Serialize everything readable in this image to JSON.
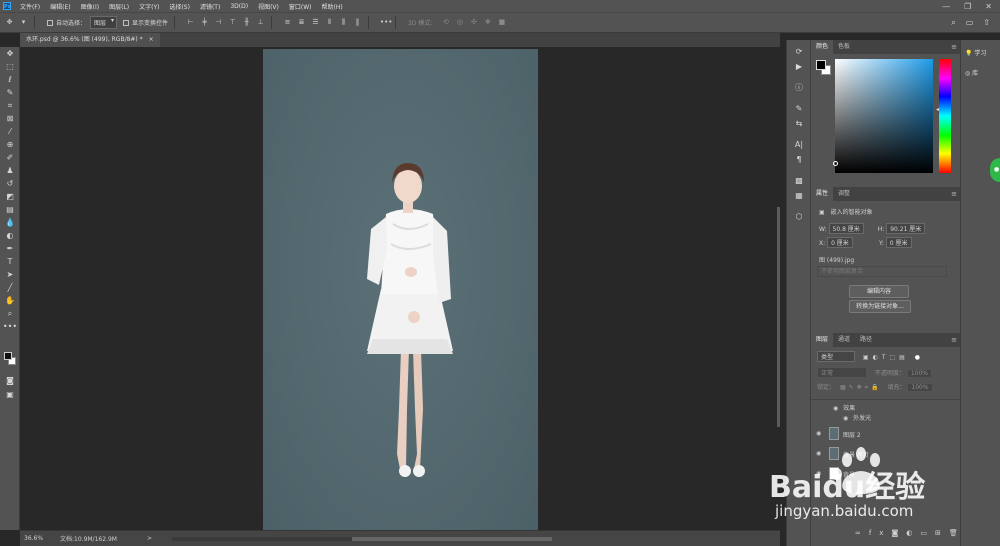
{
  "app": {
    "logo": "Ps"
  },
  "menu": [
    "文件(F)",
    "编辑(E)",
    "图像(I)",
    "图层(L)",
    "文字(Y)",
    "选择(S)",
    "滤镜(T)",
    "3D(D)",
    "视图(V)",
    "窗口(W)",
    "帮助(H)"
  ],
  "options": {
    "auto_select_label": "自动选择：",
    "auto_select_value": "图层",
    "show_transform_label": "显示变换控件",
    "mode_3d_label": "3D 模式："
  },
  "document_tab": {
    "title": "水环.psd @ 36.6% (图 (499), RGB/8#) *",
    "close": "×"
  },
  "status": {
    "zoom": "36.6%",
    "docsize": "文档:10.9M/162.9M",
    "arrow": ">"
  },
  "color_panel": {
    "tabs": [
      "颜色",
      "色板"
    ],
    "hue_marker": "◂"
  },
  "properties_panel": {
    "tabs": [
      "属性",
      "调整"
    ],
    "object_type": "嵌入的智能对象",
    "w_label": "W:",
    "w_value": "50.8 厘米",
    "h_label": "H:",
    "h_value": "90.21 厘米",
    "x_label": "X:",
    "x_value": "0 厘米",
    "y_label": "Y:",
    "y_value": "0 厘米",
    "filename": "图 (499).jpg",
    "comp_placeholder": "不使用图层复合",
    "edit_contents_btn": "编辑内容",
    "convert_linked_btn": "转换为链接对象..."
  },
  "layers_panel": {
    "tabs": [
      "图层",
      "通道",
      "路径"
    ],
    "filter_label": "类型",
    "blend_mode": "正常",
    "opacity_label": "不透明度：",
    "opacity_value": "100%",
    "lock_label": "锁定：",
    "fill_label": "填充：",
    "fill_value": "100%",
    "effects_label": "效果",
    "outer_glow_label": "外发光",
    "layer2_name": "图层 2",
    "bg_name": "背景 拷贝",
    "bg2_name": "背景"
  },
  "right_column": {
    "learn_label": "学习",
    "library_label": "库"
  },
  "watermark": {
    "brand": "Baidu经验",
    "url": "jingyan.baidu.com"
  },
  "colors": {
    "canvas_bg": "#54686f",
    "ui_panel": "#535353",
    "workspace": "#282828",
    "accent_blue": "#31a8ff"
  }
}
